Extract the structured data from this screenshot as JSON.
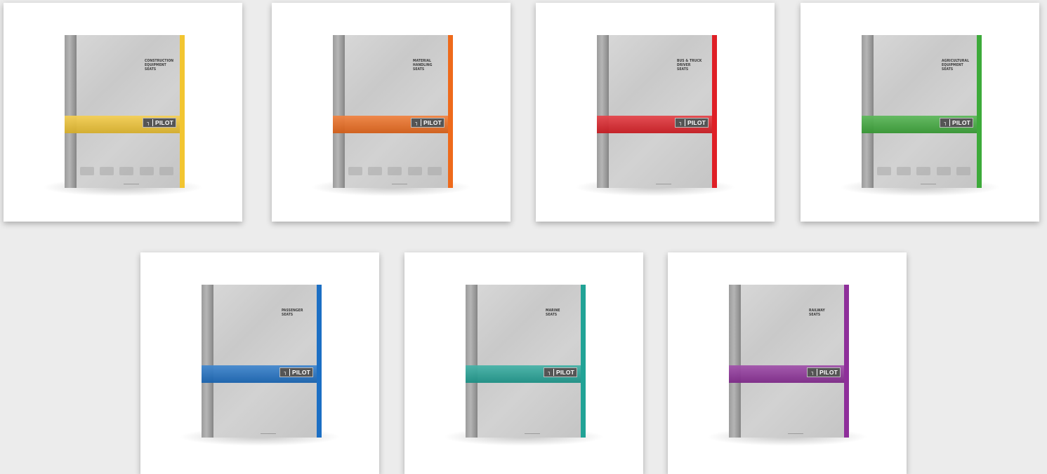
{
  "covers": [
    {
      "title_lines": [
        "CONSTRUCTION",
        "EQUIPMENT",
        "SEATS"
      ],
      "logo": "PILOT",
      "color": "#f2c531",
      "vehicles": true
    },
    {
      "title_lines": [
        "MATERIAL",
        "HANDLING",
        "SEATS"
      ],
      "logo": "PILOT",
      "color": "#ee6a1b",
      "vehicles": true
    },
    {
      "title_lines": [
        "BUS & TRUCK",
        "DRIVER",
        "SEATS"
      ],
      "logo": "PILOT",
      "color": "#df1f26",
      "vehicles": false
    },
    {
      "title_lines": [
        "AGRICULTURAL",
        "EQUIPMENT",
        "SEATS"
      ],
      "logo": "PILOT",
      "color": "#3daa3a",
      "vehicles": true
    },
    {
      "title_lines": [
        "PASSENGER",
        "SEATS"
      ],
      "logo": "PILOT",
      "color": "#1c6fc4",
      "vehicles": false
    },
    {
      "title_lines": [
        "MARINE",
        "SEATS"
      ],
      "logo": "PILOT",
      "color": "#21a396",
      "vehicles": false
    },
    {
      "title_lines": [
        "RAILWAY",
        "SEATS"
      ],
      "logo": "PILOT",
      "color": "#8e2f9a",
      "vehicles": false
    }
  ]
}
